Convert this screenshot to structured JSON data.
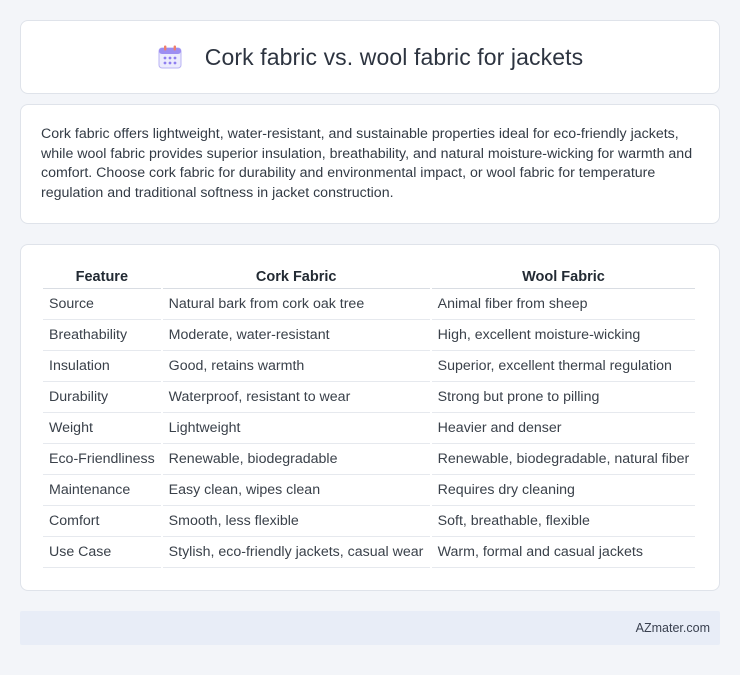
{
  "header": {
    "title": "Cork fabric vs. wool fabric for jackets",
    "icon": "calendar-icon"
  },
  "summary": "Cork fabric offers lightweight, water-resistant, and sustainable properties ideal for eco-friendly jackets, while wool fabric provides superior insulation, breathability, and natural moisture-wicking for warmth and comfort. Choose cork fabric for durability and environmental impact, or wool fabric for temperature regulation and traditional softness in jacket construction.",
  "table": {
    "headers": [
      "Feature",
      "Cork Fabric",
      "Wool Fabric"
    ],
    "rows": [
      [
        "Source",
        "Natural bark from cork oak tree",
        "Animal fiber from sheep"
      ],
      [
        "Breathability",
        "Moderate, water-resistant",
        "High, excellent moisture-wicking"
      ],
      [
        "Insulation",
        "Good, retains warmth",
        "Superior, excellent thermal regulation"
      ],
      [
        "Durability",
        "Waterproof, resistant to wear",
        "Strong but prone to pilling"
      ],
      [
        "Weight",
        "Lightweight",
        "Heavier and denser"
      ],
      [
        "Eco-Friendliness",
        "Renewable, biodegradable",
        "Renewable, biodegradable, natural fiber"
      ],
      [
        "Maintenance",
        "Easy clean, wipes clean",
        "Requires dry cleaning"
      ],
      [
        "Comfort",
        "Smooth, less flexible",
        "Soft, breathable, flexible"
      ],
      [
        "Use Case",
        "Stylish, eco-friendly jackets, casual wear",
        "Warm, formal and casual jackets"
      ]
    ]
  },
  "footer": {
    "brand": "AZmater.com"
  },
  "colors": {
    "background": "#f3f5f9",
    "card": "#ffffff",
    "footer": "#e8edf7",
    "icon_accent": "#8f7ff0"
  }
}
